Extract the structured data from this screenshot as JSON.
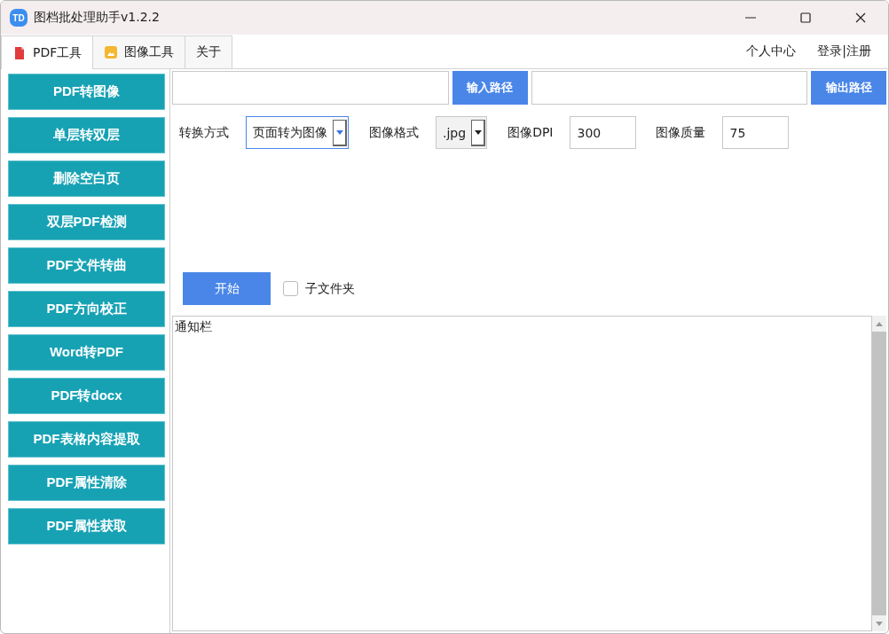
{
  "window": {
    "logo_text": "TD",
    "title": "图档批处理助手v1.2.2"
  },
  "tabs": [
    {
      "label": "PDF工具",
      "kind": "pdf",
      "selected": true
    },
    {
      "label": "图像工具",
      "kind": "image",
      "selected": false
    },
    {
      "label": "关于",
      "kind": "plain",
      "selected": false
    }
  ],
  "account_links": [
    {
      "label": "个人中心"
    },
    {
      "label": "登录|注册"
    }
  ],
  "sidebar": {
    "items": [
      {
        "label": "PDF转图像"
      },
      {
        "label": "单层转双层"
      },
      {
        "label": "删除空白页"
      },
      {
        "label": "双层PDF检测"
      },
      {
        "label": "PDF文件转曲"
      },
      {
        "label": "PDF方向校正"
      },
      {
        "label": "Word转PDF"
      },
      {
        "label": "PDF转docx"
      },
      {
        "label": "PDF表格内容提取"
      },
      {
        "label": "PDF属性清除"
      },
      {
        "label": "PDF属性获取"
      }
    ]
  },
  "paths": [
    {
      "button": "输入路径"
    },
    {
      "button": "输出路径"
    }
  ],
  "options": [
    {
      "kind": "select",
      "label": "转换方式",
      "value": "页面转为图像",
      "focused": true
    },
    {
      "kind": "select",
      "label": "图像格式",
      "value": ".jpg",
      "focused": false
    },
    {
      "kind": "input",
      "label": "图像DPI",
      "value": "300"
    },
    {
      "kind": "input",
      "label": "图像质量",
      "value": "75"
    }
  ],
  "start_button": "开始",
  "subfolder": {
    "label": "子文件夹",
    "checked": false
  },
  "notification": {
    "text": "通知栏"
  }
}
